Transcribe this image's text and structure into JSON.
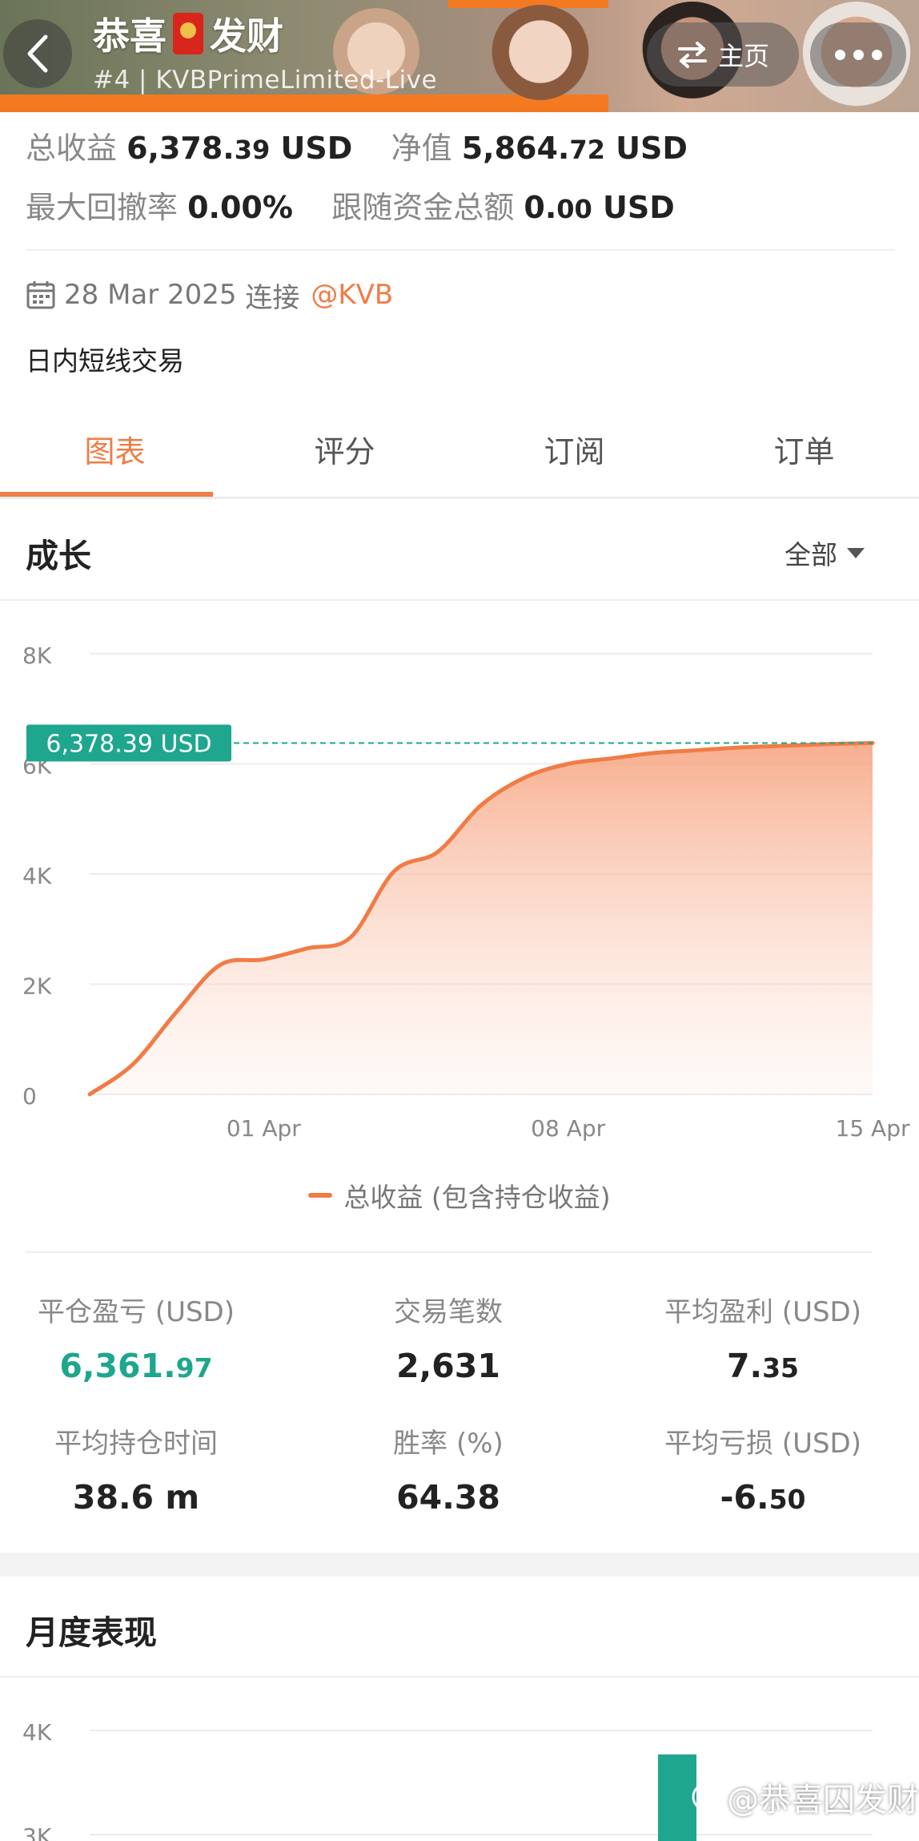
{
  "header": {
    "title_part1": "恭喜",
    "title_part2": "发财",
    "subtitle": "#4 | KVBPrimeLimited-Live",
    "home_label": "主页"
  },
  "stats": {
    "total_profit_label": "总收益",
    "total_profit_int": "6,378.",
    "total_profit_dec": "39",
    "total_profit_unit": "USD",
    "equity_label": "净值",
    "equity_int": "5,864.",
    "equity_dec": "72",
    "equity_unit": "USD",
    "max_drawdown_label": "最大回撤率",
    "max_drawdown_value": "0.00%",
    "follow_total_label": "跟随资金总额",
    "follow_total_int": "0.",
    "follow_total_dec": "00",
    "follow_total_unit": "USD"
  },
  "connection": {
    "date": "28 Mar 2025",
    "connect_label": "连接",
    "broker": "@KVB"
  },
  "description": "日内短线交易",
  "tabs": [
    {
      "label": "图表",
      "active": true
    },
    {
      "label": "评分",
      "active": false
    },
    {
      "label": "订阅",
      "active": false
    },
    {
      "label": "订单",
      "active": false
    }
  ],
  "growth": {
    "title": "成长",
    "range": "全部"
  },
  "chart_data": [
    {
      "type": "area",
      "title": "",
      "xlabel": "",
      "ylabel": "",
      "y_tick_labels": [
        "0",
        "2K",
        "4K",
        "6K",
        "8K"
      ],
      "y_ticks": [
        0,
        2000,
        4000,
        6000,
        8000
      ],
      "ylim": [
        0,
        8000
      ],
      "x_tick_labels": [
        "01 Apr",
        "08 Apr",
        "15 Apr"
      ],
      "x_ticks": [
        "2025-04-01",
        "2025-04-08",
        "2025-04-15"
      ],
      "xlim": [
        "2025-03-28",
        "2025-04-15"
      ],
      "grid": true,
      "legend_position": "bottom",
      "series": [
        {
          "name": "总收益 (包含持仓收益)",
          "color": "#f07c46",
          "x": [
            "2025-03-28",
            "2025-03-29",
            "2025-03-30",
            "2025-03-31",
            "2025-04-01",
            "2025-04-02",
            "2025-04-03",
            "2025-04-04",
            "2025-04-05",
            "2025-04-06",
            "2025-04-07",
            "2025-04-08",
            "2025-04-09",
            "2025-04-10",
            "2025-04-11",
            "2025-04-12",
            "2025-04-13",
            "2025-04-14",
            "2025-04-15"
          ],
          "values": [
            0,
            550,
            1500,
            2350,
            2450,
            2650,
            2850,
            4050,
            4400,
            5250,
            5750,
            6000,
            6100,
            6200,
            6250,
            6300,
            6330,
            6360,
            6378.39
          ]
        }
      ],
      "current_value_label": "6,378.39 USD",
      "current_value": 6378.39,
      "accent_color": "#1ea68e"
    },
    {
      "type": "bar",
      "title": "",
      "y_tick_labels": [
        "3K",
        "4K"
      ],
      "y_ticks": [
        3000,
        4000
      ],
      "visible_bar_color": "#1ea68e"
    }
  ],
  "metrics": [
    {
      "label": "平仓盈亏 (USD)",
      "int": "6,361.",
      "dec": "97",
      "highlight": true
    },
    {
      "label": "交易笔数",
      "int": "2,631",
      "dec": "",
      "highlight": false
    },
    {
      "label": "平均盈利 (USD)",
      "int": "7.",
      "dec": "35",
      "highlight": false
    },
    {
      "label": "平均持仓时间",
      "int": "38.6 m",
      "dec": "",
      "highlight": false
    },
    {
      "label": "胜率 (%)",
      "int": "64.38",
      "dec": "",
      "highlight": false
    },
    {
      "label": "平均亏损 (USD)",
      "int": "-6.",
      "dec": "50",
      "highlight": false
    }
  ],
  "monthly": {
    "title": "月度表现"
  },
  "watermark": "@恭喜囚发财",
  "colors": {
    "accent_orange": "#f07c46",
    "accent_green": "#1ea68e"
  }
}
